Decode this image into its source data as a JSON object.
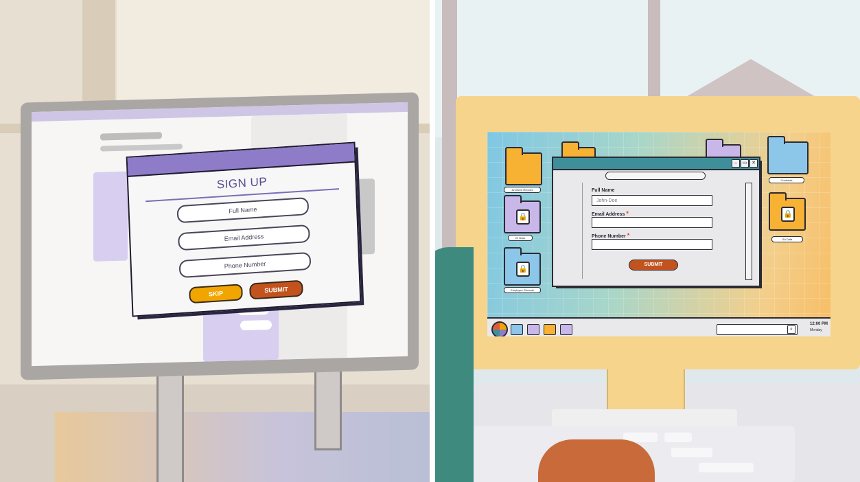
{
  "left": {
    "signup": {
      "title": "SIGN UP",
      "fields": [
        "Full Name",
        "Email Address",
        "Phone Number"
      ],
      "skip_label": "SKIP",
      "submit_label": "SUBMIT"
    },
    "colors": {
      "header": "#8f7cc8",
      "skip": "#f1a500",
      "submit": "#c3531e"
    }
  },
  "right": {
    "form": {
      "full_name_label": "Full Name",
      "full_name_placeholder": "John-Doe",
      "email_label": "Email Address",
      "phone_label": "Phone Number",
      "required_marker": "*",
      "submit_label": "SUBMIT"
    },
    "desktop": {
      "folders": [
        {
          "label": "Archived Reports",
          "icon": "folder-icon",
          "color": "#f7b133"
        },
        {
          "label": "ID Data",
          "icon": "locked-folder-icon",
          "color": "#c9b7ea"
        },
        {
          "label": "Employee Records",
          "icon": "locked-folder-icon",
          "color": "#8cc6e8"
        },
        {
          "label": "Contracts",
          "icon": "folder-icon",
          "color": "#8cc6e8"
        },
        {
          "label": "SA Data",
          "icon": "locked-folder-icon",
          "color": "#f7b133"
        }
      ],
      "window_controls": [
        "minimize-icon",
        "maximize-icon",
        "close-icon"
      ]
    },
    "taskbar": {
      "time": "12:00 PM",
      "day": "Monday",
      "pinned": [
        "folder-blue",
        "folder-purple",
        "folder-orange",
        "folder-purple"
      ]
    }
  }
}
